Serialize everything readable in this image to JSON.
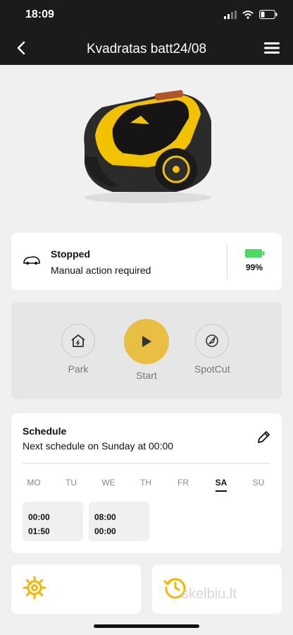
{
  "status_bar": {
    "time": "18:09"
  },
  "header": {
    "title": "Kvadratas batt24/08"
  },
  "mower_status": {
    "title": "Stopped",
    "subtitle": "Manual action required",
    "battery": "99%"
  },
  "controls": {
    "park_label": "Park",
    "start_label": "Start",
    "spotcut_label": "SpotCut"
  },
  "schedule": {
    "title": "Schedule",
    "subtitle": "Next schedule on Sunday at 00:00",
    "days": [
      "MO",
      "TU",
      "WE",
      "TH",
      "FR",
      "SA",
      "SU"
    ],
    "selected_day": "SA",
    "slots": [
      {
        "start": "00:00",
        "end": "01:50"
      },
      {
        "start": "08:00",
        "end": "00:00"
      }
    ]
  },
  "watermark": "skelbiu.lt",
  "icons": [
    "back-arrow-icon",
    "menu-icon",
    "mower-icon",
    "battery-icon",
    "park-house-icon",
    "play-icon",
    "spotcut-icon",
    "pencil-icon",
    "gear-icon",
    "history-icon"
  ],
  "colors": {
    "accent": "#e8bf42",
    "battery": "#4cd964",
    "header_bg": "#1b1b1b",
    "icon_yellow": "#f2b705"
  }
}
